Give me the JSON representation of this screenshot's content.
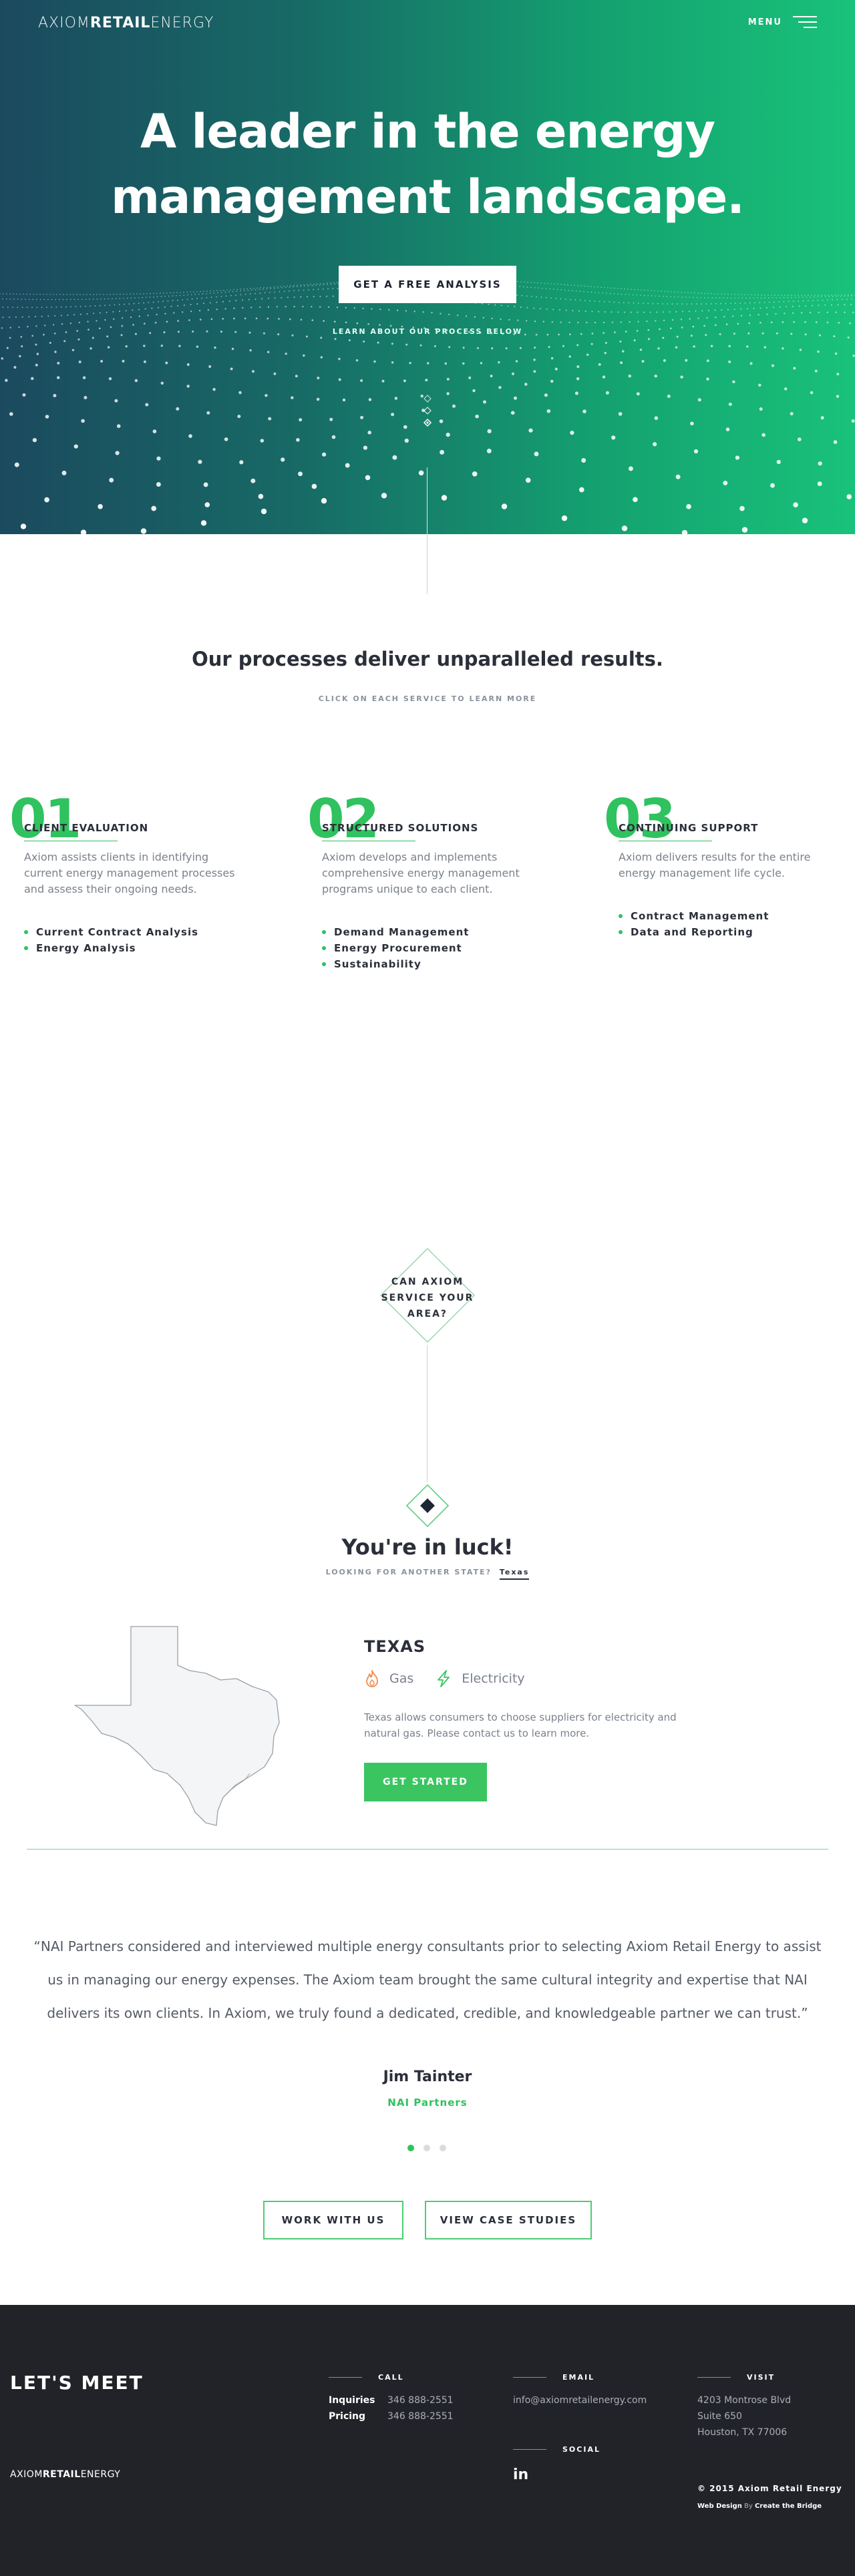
{
  "brand": {
    "logo_part1": "AXIOM",
    "logo_part2": "RETAIL",
    "logo_part3": "ENERGY",
    "accent_color": "#2fc25e"
  },
  "nav": {
    "menu_label": "MENU",
    "menu_icon": "hamburger-icon"
  },
  "hero": {
    "title_line1": "A leader in the energy",
    "title_line2": "management landscape.",
    "cta_label": "GET A FREE ANALYSIS",
    "learn_label": "LEARN ABOUT OUR PROCESS BELOW"
  },
  "processes": {
    "title": "Our processes deliver unparalleled results.",
    "subtitle": "CLICK ON EACH SERVICE TO LEARN MORE",
    "services": [
      {
        "num": "01",
        "name": "CLIENT EVALUATION",
        "desc": "Axiom assists clients in identifying current energy management processes and assess their ongoing needs.",
        "items": [
          "Current Contract Analysis",
          "Energy Analysis"
        ]
      },
      {
        "num": "02",
        "name": "STRUCTURED SOLUTIONS",
        "desc": "Axiom develops and implements comprehensive energy management programs unique to each client.",
        "items": [
          "Demand Management",
          "Energy Procurement",
          "Sustainability"
        ]
      },
      {
        "num": "03",
        "name": "CONTINUING SUPPORT",
        "desc": "Axiom delivers results for the entire energy management life cycle.",
        "items": [
          "Contract Management",
          "Data and Reporting"
        ]
      }
    ]
  },
  "service_area": {
    "question_line1": "CAN AXIOM",
    "question_line2": "SERVICE YOUR",
    "question_line3": "AREA?",
    "result_title": "You're in luck!",
    "another_label": "LOOKING FOR ANOTHER STATE?",
    "selected_state": "Texas",
    "state_name": "TEXAS",
    "utilities": [
      {
        "label": "Gas",
        "icon": "flame-icon"
      },
      {
        "label": "Electricity",
        "icon": "lightning-icon"
      }
    ],
    "description": "Texas allows consumers to choose suppliers for electricity and natural gas. Please contact us to learn more.",
    "cta_label": "GET STARTED"
  },
  "testimonial": {
    "quote": "“NAI Partners considered and interviewed multiple energy consultants prior to selecting Axiom Retail Energy to assist us in managing our energy expenses. The Axiom team brought the same cultural integrity and expertise that NAI delivers its own clients. In Axiom, we truly found a dedicated, credible, and knowledgeable partner we can trust.”",
    "person": "Jim Tainter",
    "company": "NAI Partners",
    "slides_total": 3,
    "active_slide": 1
  },
  "actions": {
    "work_label": "WORK WITH US",
    "cases_label": "VIEW CASE STUDIES"
  },
  "footer": {
    "title": "LET'S MEET",
    "call_heading": "CALL",
    "inquiries_label": "Inquiries",
    "inquiries_phone": "346 888-2551",
    "pricing_label": "Pricing",
    "pricing_phone": "346 888-2551",
    "email_heading": "EMAIL",
    "email": "info@axiomretailenergy.com",
    "social_heading": "SOCIAL",
    "social_icon": "linkedin-icon",
    "social_text": "in",
    "visit_heading": "VISIT",
    "address_line1": "4203 Montrose Blvd",
    "address_line2": "Suite 650",
    "address_line3": "Houston, TX 77006",
    "copyright": "© 2015 Axiom Retail Energy",
    "credit_label": "Web Design",
    "credit_by": "By",
    "credit_name": "Create the Bridge"
  }
}
